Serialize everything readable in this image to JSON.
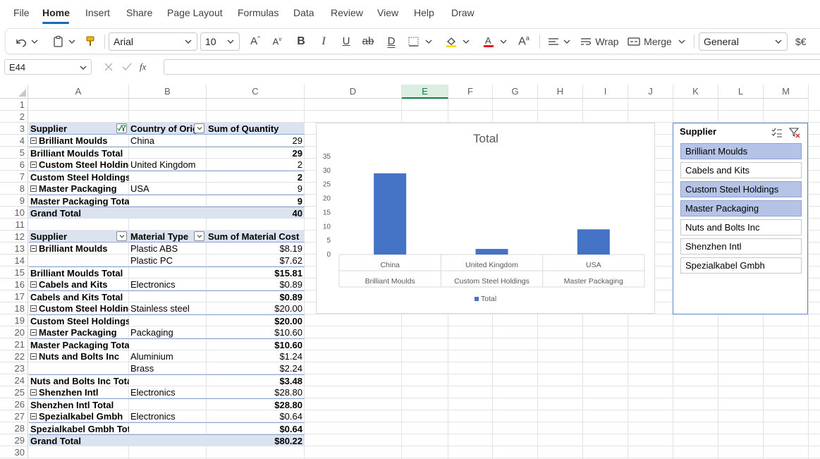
{
  "menu": {
    "items": [
      "File",
      "Home",
      "Insert",
      "Share",
      "Page Layout",
      "Formulas",
      "Data",
      "Review",
      "View",
      "Help",
      "Draw"
    ],
    "active": "Home"
  },
  "ribbon": {
    "font": "Arial",
    "size": "10",
    "wrap": "Wrap",
    "merge": "Merge",
    "number_format": "General"
  },
  "formula_bar": {
    "name_box": "E44",
    "fx": "fx",
    "formula": ""
  },
  "columns": [
    "A",
    "B",
    "C",
    "D",
    "E",
    "F",
    "G",
    "H",
    "I",
    "J",
    "K",
    "L",
    "M"
  ],
  "selected_column": "E",
  "rows": [
    "1",
    "2",
    "3",
    "4",
    "5",
    "6",
    "7",
    "8",
    "9",
    "10",
    "11",
    "12",
    "13",
    "14",
    "15",
    "16",
    "17",
    "18",
    "19",
    "20",
    "21",
    "22",
    "23",
    "24",
    "25",
    "26",
    "27",
    "28",
    "29",
    "30"
  ],
  "pivot1": {
    "headers": [
      "Supplier",
      "Country of Orig",
      "Sum of Quantity"
    ],
    "rows": [
      {
        "a": "Brilliant Moulds",
        "b": "China",
        "c": "29",
        "type": "item"
      },
      {
        "a": "Brilliant Moulds Total",
        "b": "",
        "c": "29",
        "type": "subtotal"
      },
      {
        "a": "Custom Steel Holding",
        "b": "United Kingdom",
        "c": "2",
        "type": "item"
      },
      {
        "a": "Custom Steel Holdings Total",
        "b": "",
        "c": "2",
        "type": "subtotal"
      },
      {
        "a": "Master Packaging",
        "b": "USA",
        "c": "9",
        "type": "item"
      },
      {
        "a": "Master Packaging Total",
        "b": "",
        "c": "9",
        "type": "subtotal"
      },
      {
        "a": "Grand Total",
        "b": "",
        "c": "40",
        "type": "grand"
      }
    ]
  },
  "pivot2": {
    "headers": [
      "Supplier",
      "Material Type",
      "Sum of Material Cost"
    ],
    "rows": [
      {
        "a": "Brilliant Moulds",
        "b": "Plastic ABS",
        "c": "$8.19",
        "type": "item"
      },
      {
        "a": "",
        "b": "Plastic PC",
        "c": "$7.62",
        "type": "cont"
      },
      {
        "a": "Brilliant Moulds Total",
        "b": "",
        "c": "$15.81",
        "type": "subtotal"
      },
      {
        "a": "Cabels and Kits",
        "b": "Electronics",
        "c": "$0.89",
        "type": "item"
      },
      {
        "a": "Cabels and Kits Total",
        "b": "",
        "c": "$0.89",
        "type": "subtotal"
      },
      {
        "a": "Custom Steel Holding",
        "b": "Stainless steel",
        "c": "$20.00",
        "type": "item"
      },
      {
        "a": "Custom Steel Holdings Total",
        "b": "",
        "c": "$20.00",
        "type": "subtotal"
      },
      {
        "a": "Master Packaging",
        "b": "Packaging",
        "c": "$10.60",
        "type": "item"
      },
      {
        "a": "Master Packaging Total",
        "b": "",
        "c": "$10.60",
        "type": "subtotal"
      },
      {
        "a": "Nuts and Bolts Inc",
        "b": "Aluminium",
        "c": "$1.24",
        "type": "item"
      },
      {
        "a": "",
        "b": "Brass",
        "c": "$2.24",
        "type": "cont"
      },
      {
        "a": "Nuts and Bolts Inc Total",
        "b": "",
        "c": "$3.48",
        "type": "subtotal"
      },
      {
        "a": "Shenzhen Intl",
        "b": "Electronics",
        "c": "$28.80",
        "type": "item"
      },
      {
        "a": "Shenzhen Intl Total",
        "b": "",
        "c": "$28.80",
        "type": "subtotal"
      },
      {
        "a": "Spezialkabel Gmbh",
        "b": "Electronics",
        "c": "$0.64",
        "type": "item"
      },
      {
        "a": "Spezialkabel Gmbh Total",
        "b": "",
        "c": "$0.64",
        "type": "subtotal"
      },
      {
        "a": "Grand Total",
        "b": "",
        "c": "$80.22",
        "type": "grand"
      }
    ]
  },
  "chart_data": {
    "type": "bar",
    "title": "Total",
    "categories": [
      "China",
      "United Kingdom",
      "USA"
    ],
    "group_labels": [
      "Brilliant Moulds",
      "Custom Steel Holdings",
      "Master Packaging"
    ],
    "series": [
      {
        "name": "Total",
        "values": [
          29,
          2,
          9
        ]
      }
    ],
    "ylim": [
      0,
      35
    ],
    "yticks": [
      "0",
      "5",
      "10",
      "15",
      "20",
      "25",
      "30",
      "35"
    ],
    "bar_color": "#4472c4",
    "grid": false,
    "legend": "bottom"
  },
  "slicer": {
    "title": "Supplier",
    "items": [
      {
        "label": "Brilliant Moulds",
        "selected": true
      },
      {
        "label": "Cabels and Kits",
        "selected": false
      },
      {
        "label": "Custom Steel Holdings",
        "selected": true
      },
      {
        "label": "Master Packaging",
        "selected": true
      },
      {
        "label": "Nuts and Bolts Inc",
        "selected": false
      },
      {
        "label": "Shenzhen Intl",
        "selected": false
      },
      {
        "label": "Spezialkabel Gmbh",
        "selected": false
      }
    ]
  }
}
